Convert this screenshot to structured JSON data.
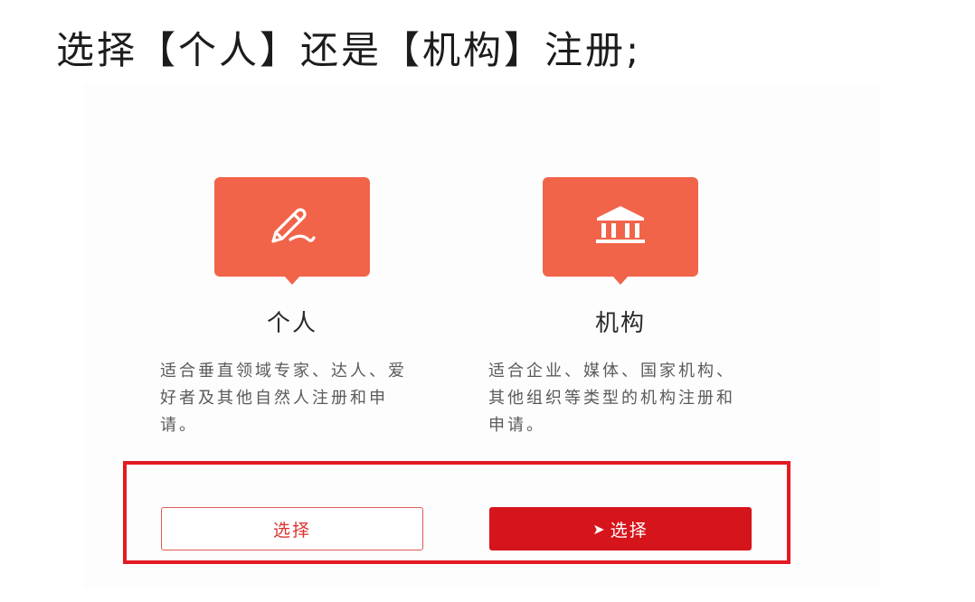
{
  "headline": "选择【个人】还是【机构】注册;",
  "options": [
    {
      "title": "个人",
      "icon": "pen-icon",
      "description": "适合垂直领域专家、达人、爱好者及其他自然人注册和申请。",
      "button_label": "选择"
    },
    {
      "title": "机构",
      "icon": "institution-icon",
      "description": "适合企业、媒体、国家机构、其他组织等类型的机构注册和申请。",
      "button_label": "选择"
    }
  ],
  "colors": {
    "icon_tile": "#f2644a",
    "highlight_border": "#e21b23",
    "button_solid": "#d6141c",
    "button_outline_text": "#d9342f"
  }
}
